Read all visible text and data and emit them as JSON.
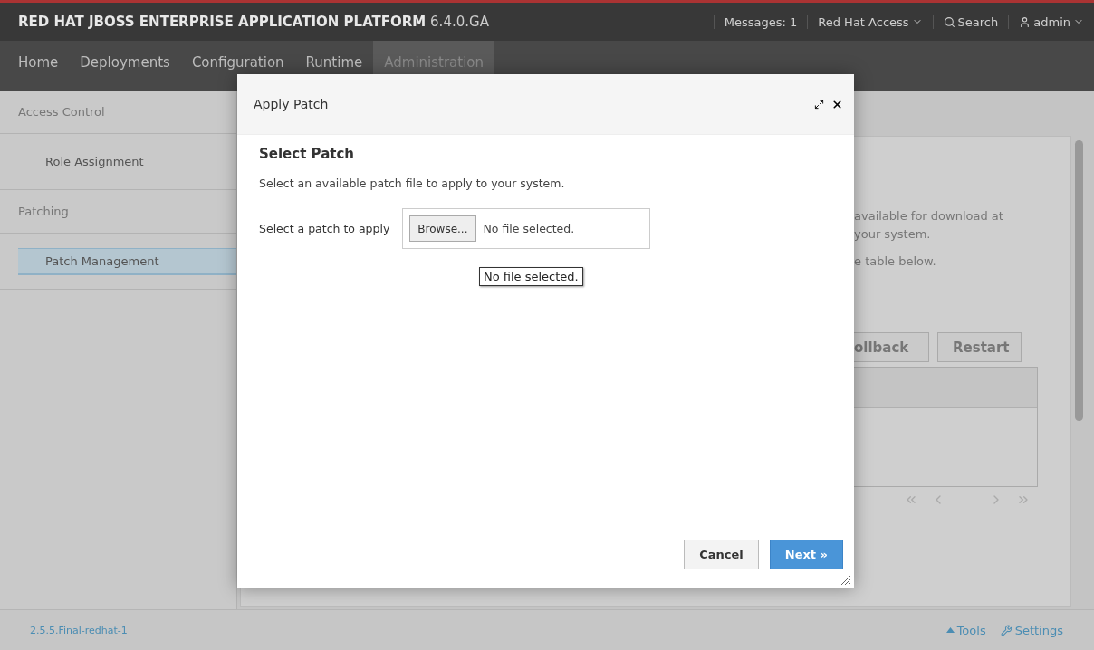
{
  "header": {
    "title": "**RED HAT JBOSS ENTERPRISE APPLICATION PLATFORM** 6.4.0.GA",
    "messages": "Messages: 1",
    "access": "Red Hat Access",
    "search": "Search",
    "user": "admin"
  },
  "nav": [
    {
      "label": "Home",
      "selected": false
    },
    {
      "label": "Deployments",
      "selected": false
    },
    {
      "label": "Configuration",
      "selected": false
    },
    {
      "label": "Runtime",
      "selected": false
    },
    {
      "label": "Administration",
      "selected": true
    }
  ],
  "sidebar": {
    "items": [
      {
        "kind": "section",
        "label": "Access Control",
        "selected": false
      },
      {
        "kind": "item",
        "label": "Role Assignment",
        "selected": false
      },
      {
        "kind": "section",
        "label": "Patching",
        "selected": false
      },
      {
        "kind": "item",
        "label": "Patch Management",
        "selected": true
      }
    ]
  },
  "content": {
    "lines": [
      "available for download at",
      "your system.",
      "e table below."
    ],
    "buttons": [
      "ollback",
      "Restart"
    ]
  },
  "dialog": {
    "title": "Apply Patch",
    "heading": "Select Patch",
    "description": "Select an available patch file to apply to your system.",
    "field_label": "Select a patch to apply",
    "browse": "Browse...",
    "file_value": "No file selected.",
    "tooltip": "No file selected.",
    "buttons": [
      {
        "kind": "secondary",
        "label": "Cancel"
      },
      {
        "kind": "primary",
        "label": "Next »"
      }
    ]
  },
  "footer": {
    "version": "2.5.5.Final-redhat-1",
    "tools": "Tools",
    "settings": "Settings"
  }
}
